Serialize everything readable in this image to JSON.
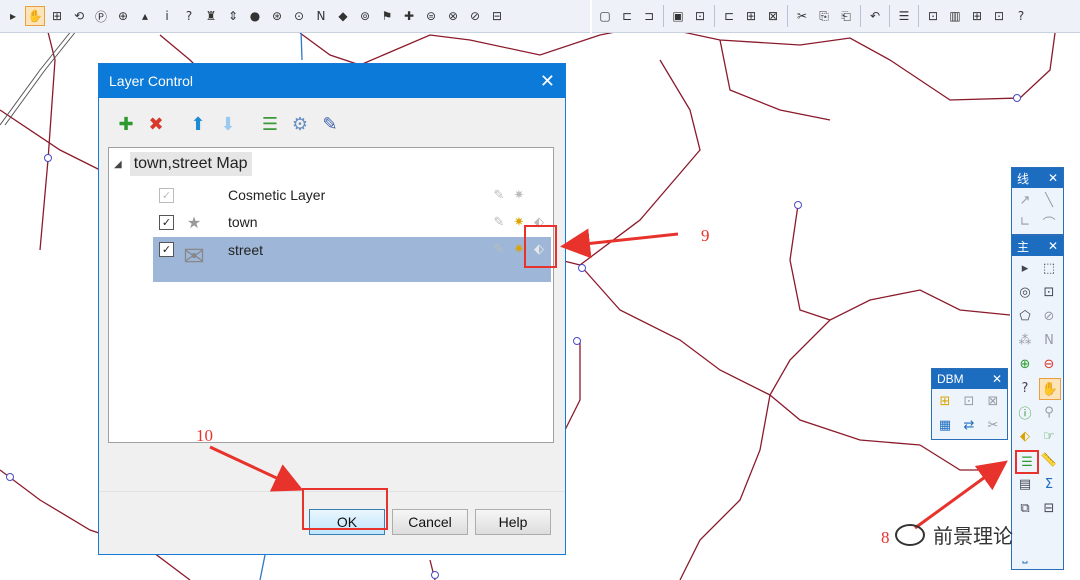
{
  "dialog": {
    "title": "Layer Control",
    "close_glyph": "✕",
    "toolbar": [
      {
        "name": "add-layer-icon",
        "glyph": "✚",
        "color": "#2e9a2e"
      },
      {
        "name": "remove-layer-icon",
        "glyph": "✖",
        "color": "#d8392b"
      },
      {
        "name": "move-up-icon",
        "glyph": "⬆",
        "color": "#1d8ad6"
      },
      {
        "name": "move-down-icon",
        "glyph": "⬇",
        "color": "#9cc9ee"
      },
      {
        "name": "layer-properties-icon",
        "glyph": "☰",
        "color": "#3a9a3a"
      },
      {
        "name": "display-settings-icon",
        "glyph": "⚙",
        "color": "#6a8fc0"
      },
      {
        "name": "label-settings-icon",
        "glyph": "✎",
        "color": "#3a5ea8"
      }
    ],
    "tree": {
      "root_label": "town,street Map",
      "expander": "◢",
      "layers": [
        {
          "name": "Cosmetic Layer",
          "checked": "✓",
          "enabled": false,
          "glyph": ""
        },
        {
          "name": "town",
          "checked": "✓",
          "enabled": true,
          "glyph": "★"
        },
        {
          "name": "street",
          "checked": "✓",
          "enabled": true,
          "glyph": "✉"
        }
      ],
      "row_icons": {
        "editable": "✎",
        "selectable": "✷",
        "label": "⬖"
      }
    },
    "buttons": {
      "ok": "OK",
      "cancel": "Cancel",
      "help": "Help"
    }
  },
  "annotations": {
    "step9": "9",
    "step10": "10",
    "step8": "8"
  },
  "colors": {
    "accent": "#0b7ad8",
    "annotation": "#e8322c",
    "map_line": "#8b1a2b",
    "selected_row": "#9eb7d8"
  },
  "panels": {
    "panel1": {
      "title": "线",
      "close": "✕"
    },
    "panel2": {
      "title": "主",
      "close": "✕"
    },
    "dbm": {
      "title": "DBM",
      "close": "✕"
    }
  },
  "watermark": {
    "text": "前景理论"
  },
  "toolbar_left": [
    "▸",
    "✋",
    "⊞",
    "⟲",
    "Ⓟ",
    "⊕",
    "▴",
    "i",
    "?",
    "♜",
    "⇕",
    "●",
    "⊛",
    "⊙",
    "N",
    "◆",
    "⊚",
    "⚑",
    "✚",
    "⊜",
    "⊗",
    "⊘",
    "⊟"
  ],
  "toolbar_right": [
    "▢",
    "⊏",
    "⊐",
    "▣",
    "⊡",
    "⊏",
    "⊞",
    "⊠",
    "✂",
    "⎘",
    "⎗",
    "↶",
    "☰",
    "⊡",
    "▥",
    "⊞",
    "⊡",
    "?"
  ]
}
